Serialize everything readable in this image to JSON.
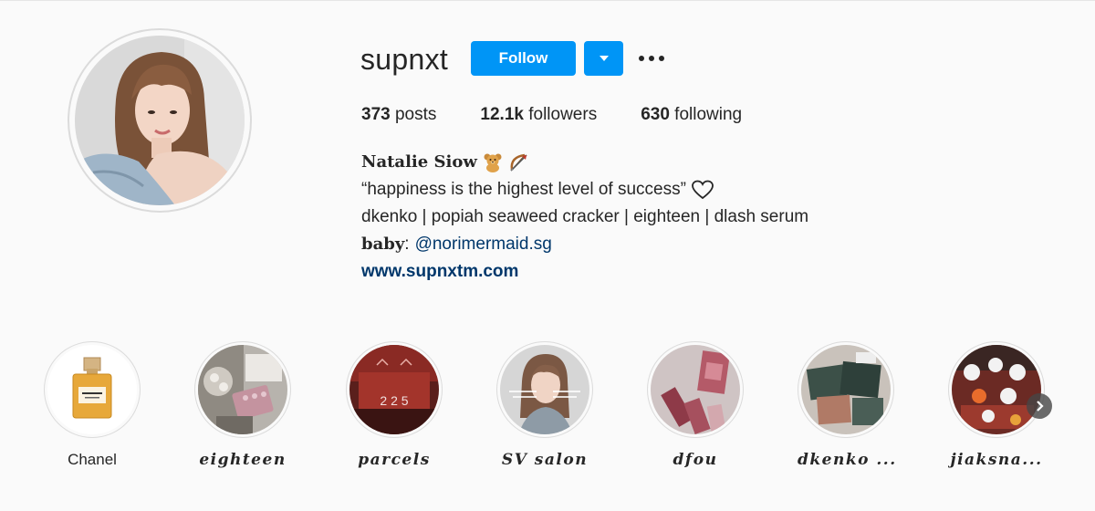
{
  "profile": {
    "username": "supnxt",
    "follow_label": "Follow",
    "avatar_icon": "profile-photo"
  },
  "stats": {
    "posts_count": "373",
    "posts_label": " posts",
    "followers_count": "12.1k",
    "followers_label": " followers",
    "following_count": "630",
    "following_label": " following"
  },
  "bio": {
    "full_name": "Natalie Siow",
    "name_emojis": [
      "teddy-bear-icon",
      "bow-and-arrow-icon"
    ],
    "quote": "“happiness is the highest level of success”",
    "brands": "dkenko | popiah seaweed cracker | eighteen | dlash serum",
    "baby_label": "baby",
    "baby_sep": ":",
    "baby_mention": "@norimermaid.sg",
    "website": "www.supnxtm.com"
  },
  "highlights": [
    {
      "label": "Chanel"
    },
    {
      "label": "eighteen"
    },
    {
      "label": "parcels"
    },
    {
      "label": "SV salon"
    },
    {
      "label": "dfou"
    },
    {
      "label": "dkenko ..."
    },
    {
      "label": "jiaksna..."
    }
  ],
  "colors": {
    "accent": "#0095f6",
    "link": "#00376b",
    "background": "#fafafa",
    "text": "#262626"
  }
}
